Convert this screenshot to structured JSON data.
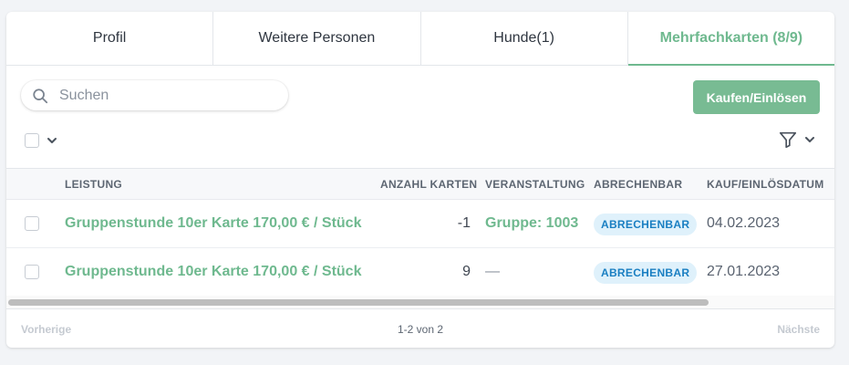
{
  "tabs": [
    {
      "label": "Profil",
      "active": false
    },
    {
      "label": "Weitere Personen",
      "active": false
    },
    {
      "label": "Hunde(1)",
      "active": false
    },
    {
      "label": "Mehrfachkarten (8/9)",
      "active": true
    }
  ],
  "search": {
    "placeholder": "Suchen",
    "value": ""
  },
  "actions": {
    "buy_label": "Kaufen/Einlösen"
  },
  "colors": {
    "accent": "#6fb98f",
    "button": "#78bb93",
    "badge_text": "#1a7fc2",
    "badge_bg": "#dff1fb"
  },
  "table": {
    "headers": {
      "service": "LEISTUNG",
      "count": "ANZAHL KARTEN",
      "event": "VERANSTALTUNG",
      "billable": "ABRECHENBAR",
      "date": "KAUF/EINLÖSDATUM"
    },
    "rows": [
      {
        "service": "Gruppenstunde 10er Karte 170,00 € / Stück",
        "count": "-1",
        "event": "Gruppe: 1003",
        "billable": "ABRECHENBAR",
        "date": "04.02.2023"
      },
      {
        "service": "Gruppenstunde 10er Karte 170,00 € / Stück",
        "count": "9",
        "event": "—",
        "billable": "ABRECHENBAR",
        "date": "27.01.2023"
      }
    ]
  },
  "pagination": {
    "prev": "Vorherige",
    "info": "1-2 von 2",
    "next": "Nächste"
  }
}
